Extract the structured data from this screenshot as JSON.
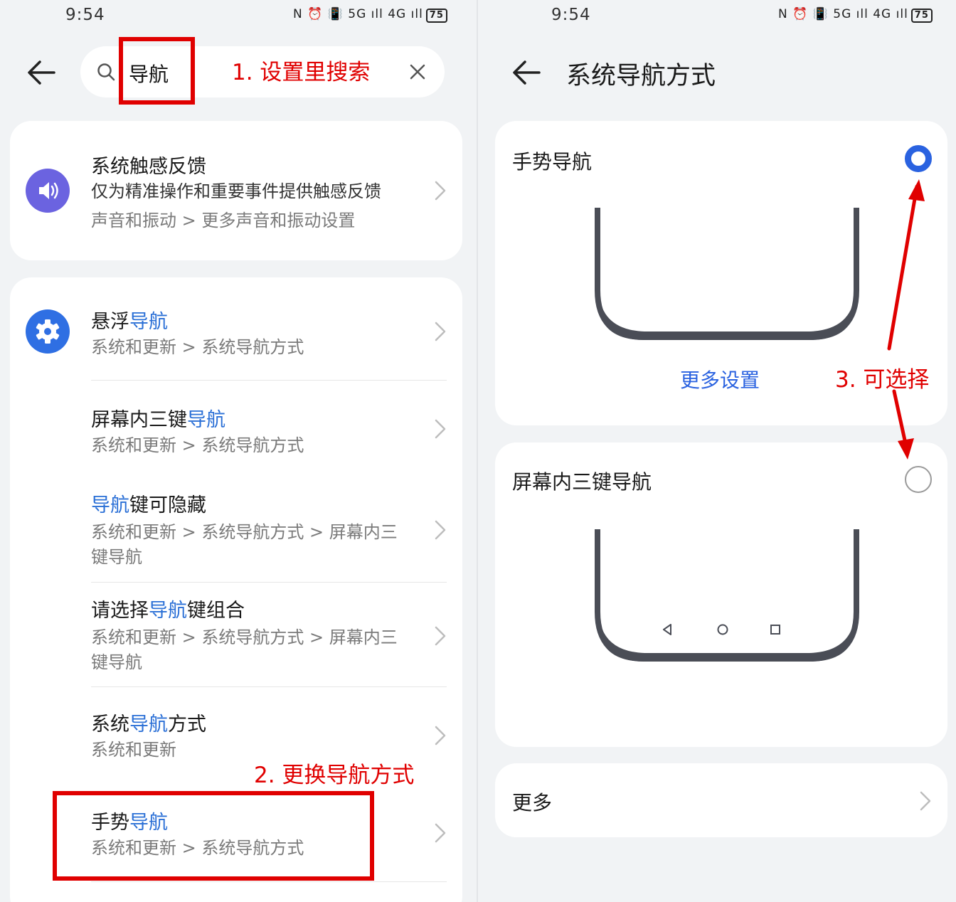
{
  "left_screen": {
    "status_bar": {
      "time": "9:54",
      "icons": "N ⏰ 📳 5G ıll 4G ıll",
      "battery": "75"
    },
    "search": {
      "value": "导航"
    },
    "results_top": {
      "title": "系统触感反馈",
      "desc": "仅为精准操作和重要事件提供触感反馈",
      "path": "声音和振动 > 更多声音和振动设置"
    },
    "results": [
      {
        "title_pre": "悬浮",
        "title_hl": "导航",
        "title_post": "",
        "path_1": "系统和更新 > 系统导航方式",
        "path_2": ""
      },
      {
        "title_pre": "屏幕内三键",
        "title_hl": "导航",
        "title_post": "",
        "path_1": "系统和更新 > 系统导航方式",
        "path_2": ""
      },
      {
        "title_pre": "",
        "title_hl": "导航",
        "title_post": "键可隐藏",
        "path_1": "系统和更新 > 系统导航方式 > 屏幕内三",
        "path_2": "键导航"
      },
      {
        "title_pre": "请选择",
        "title_hl": "导航",
        "title_post": "键组合",
        "path_1": "系统和更新 > 系统导航方式 > 屏幕内三",
        "path_2": "键导航"
      },
      {
        "title_pre": "系统",
        "title_hl": "导航",
        "title_post": "方式",
        "path_1": "系统和更新",
        "path_2": ""
      },
      {
        "title_pre": "手势",
        "title_hl": "导航",
        "title_post": "",
        "path_1": "系统和更新 > 系统导航方式",
        "path_2": ""
      }
    ],
    "annotations": {
      "step1": "1. 设置里搜索",
      "step2": "2. 更换导航方式"
    }
  },
  "right_screen": {
    "status_bar": {
      "time": "9:54",
      "icons": "N ⏰ 📳 5G ıll 4G ıll",
      "battery": "75"
    },
    "title": "系统导航方式",
    "options": [
      {
        "label": "手势导航",
        "selected": true,
        "link": "更多设置"
      },
      {
        "label": "屏幕内三键导航",
        "selected": false
      }
    ],
    "more": {
      "label": "更多"
    },
    "annotation": {
      "step3": "3. 可选择"
    }
  },
  "colors": {
    "accent": "#2a62e0",
    "highlight": "#2a6fd6",
    "annotation": "#e00000",
    "background": "#f1f3f5"
  },
  "icons": {
    "sound": "speaker-icon",
    "settings": "gear-icon",
    "back": "back-arrow-icon",
    "search": "search-icon",
    "clear": "close-icon",
    "chevron": "chevron-right-icon"
  }
}
